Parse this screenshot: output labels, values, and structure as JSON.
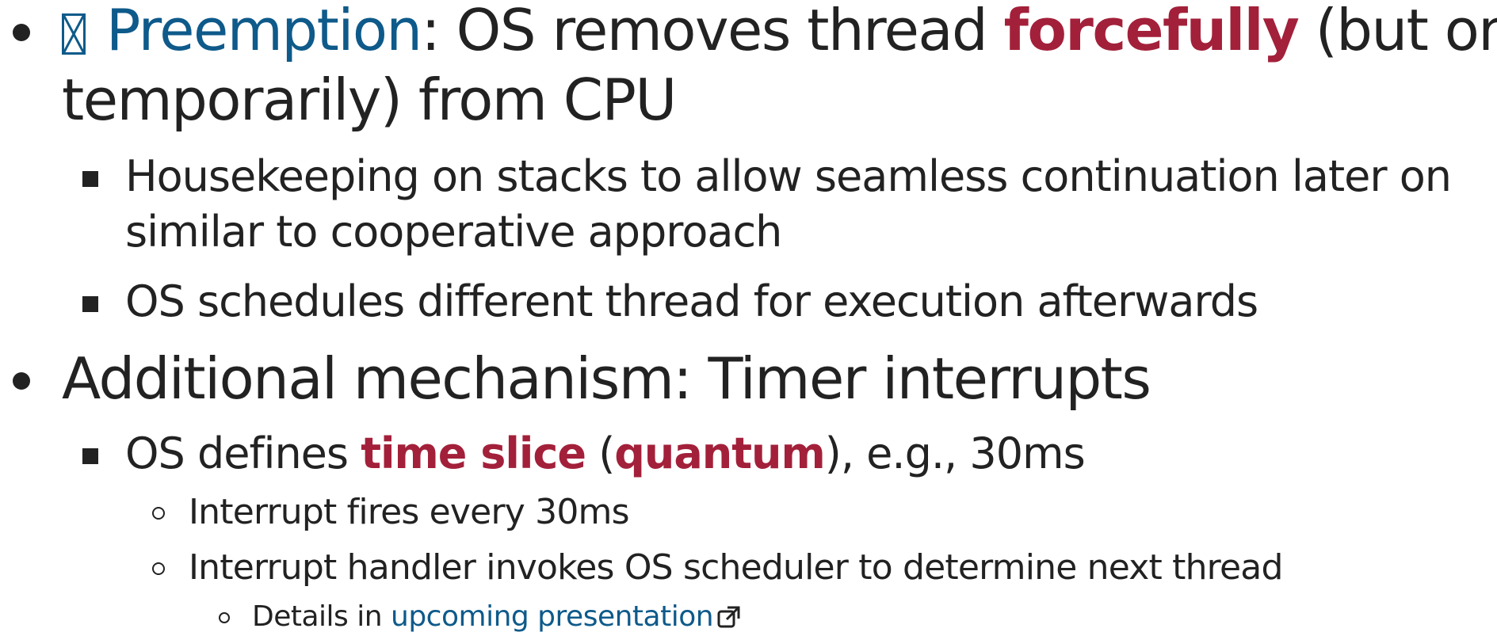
{
  "bullets": {
    "preemption": {
      "term": "Preemption",
      "text_a": ": OS removes thread ",
      "emphasis": "forcefully",
      "text_b": " (but only",
      "line2": "temporarily) from CPU"
    },
    "housekeeping": {
      "line1": "Housekeeping on stacks to allow seamless continuation later on",
      "line2": "similar to cooperative approach"
    },
    "schedules": {
      "text": "OS schedules different thread for execution afterwards"
    },
    "additional": {
      "text": "Additional mechanism: Timer interrupts"
    },
    "time_slice": {
      "text_a": "OS defines ",
      "term1": "time slice",
      "text_b": " (",
      "term2": "quantum",
      "text_c": "), e.g., 30ms"
    },
    "fires": {
      "text": "Interrupt fires every 30ms"
    },
    "handler": {
      "text": "Interrupt handler invokes OS scheduler to determine next thread"
    },
    "details": {
      "text": "Details in ",
      "link_label": "upcoming presentation"
    }
  },
  "icons": {
    "missing_glyph": "missing-glyph-icon",
    "external_link": "external-link-icon"
  },
  "colors": {
    "text": "#222222",
    "term_blue": "#0e5a8a",
    "term_red": "#a3203a"
  }
}
